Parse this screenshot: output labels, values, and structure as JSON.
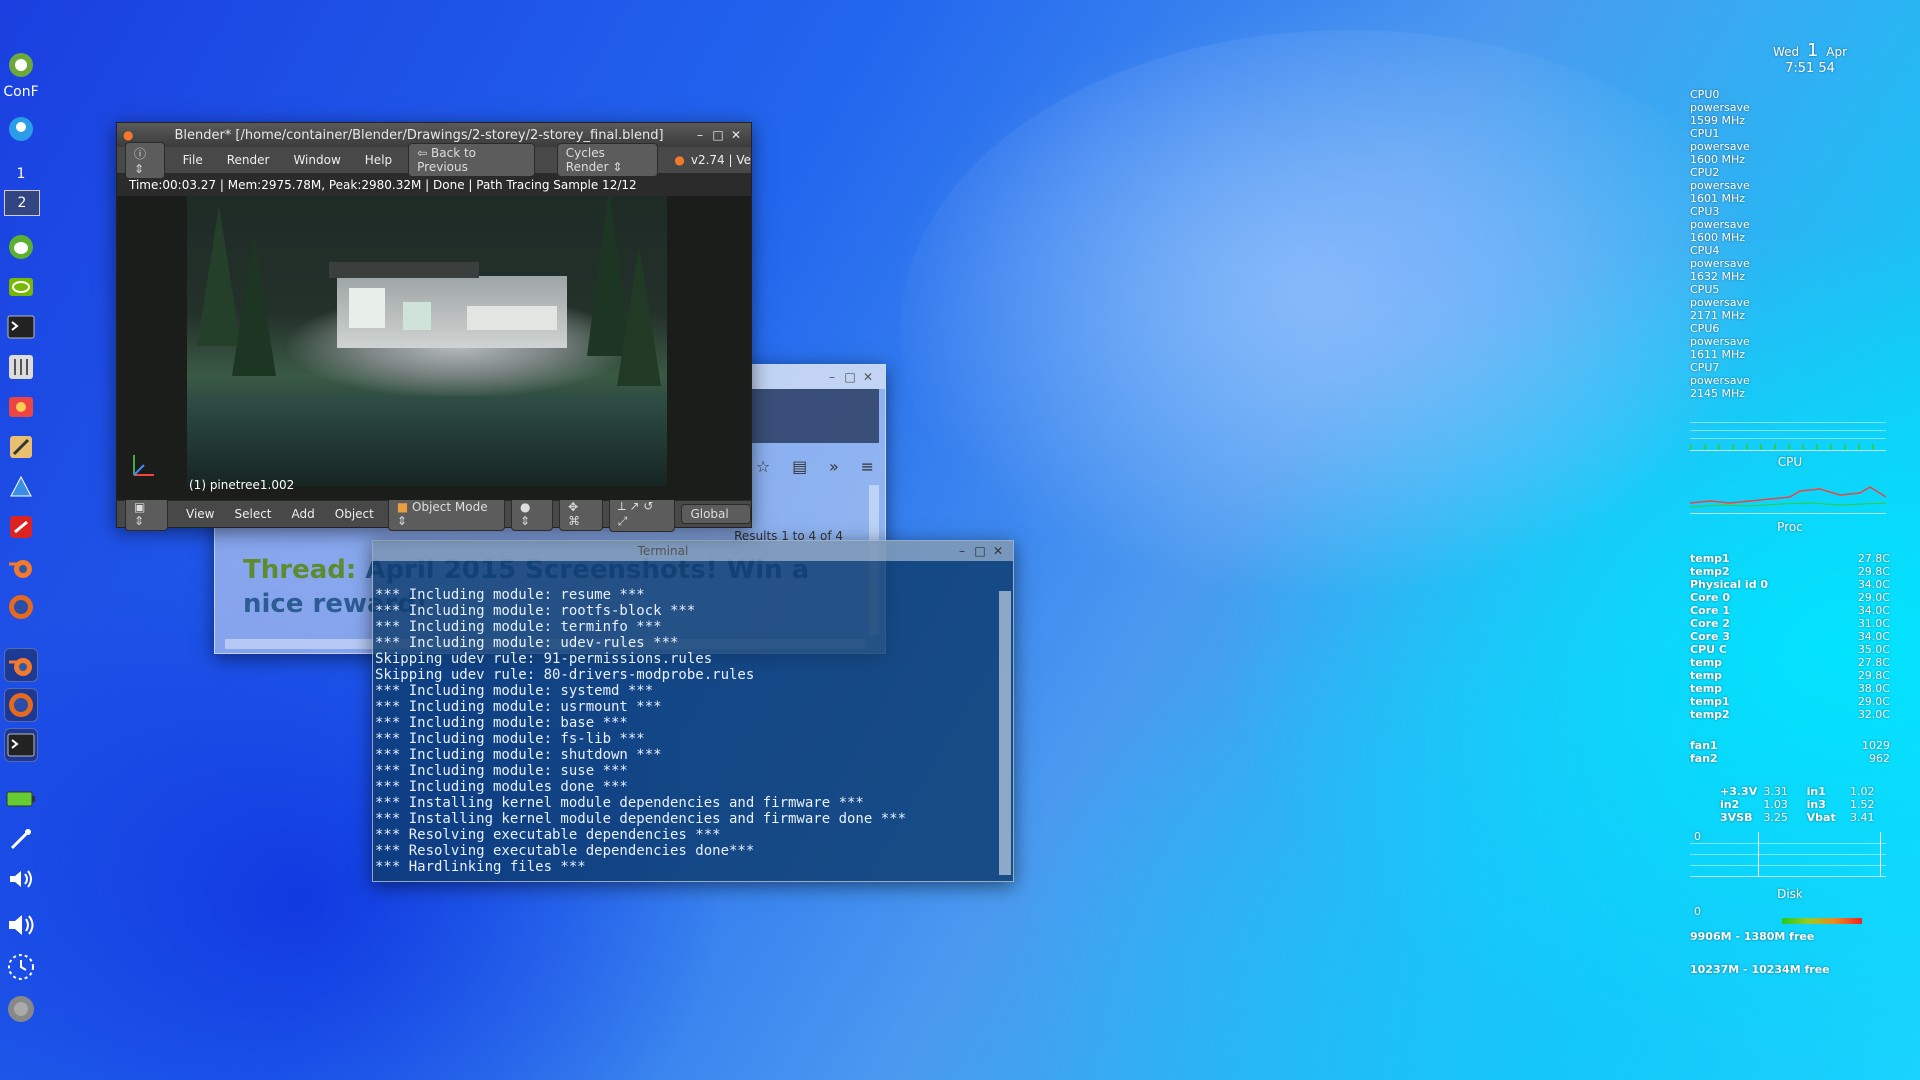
{
  "dock": {
    "conf_label": "ConF",
    "workspace_1": "1",
    "workspace_2": "2"
  },
  "blender": {
    "title": "Blender* [/home/container/Blender/Drawings/2-storey/2-storey_final.blend]",
    "menu": [
      "File",
      "Render",
      "Window",
      "Help"
    ],
    "back_label": "Back to Previous",
    "engine": "Cycles Render",
    "version": "v2.74 | Ve",
    "status": "Time:00:03.27 | Mem:2975.78M, Peak:2980.32M | Done | Path Tracing Sample 12/12",
    "object_name": "(1) pinetree1.002",
    "bottom_menu": [
      "View",
      "Select",
      "Add",
      "Object"
    ],
    "mode": "Object Mode",
    "orientation": "Global"
  },
  "browser": {
    "results": "Results 1 to 4 of 4",
    "thread_label": "Thread:",
    "thread_title": "April 2015 Screenshots! Win a nice reward!"
  },
  "terminal": {
    "title": "Terminal",
    "lines": [
      "*** Including module: resume ***",
      "*** Including module: rootfs-block ***",
      "*** Including module: terminfo ***",
      "*** Including module: udev-rules ***",
      "Skipping udev rule: 91-permissions.rules",
      "Skipping udev rule: 80-drivers-modprobe.rules",
      "*** Including module: systemd ***",
      "*** Including module: usrmount ***",
      "*** Including module: base ***",
      "*** Including module: fs-lib ***",
      "*** Including module: shutdown ***",
      "*** Including module: suse ***",
      "*** Including modules done ***",
      "*** Installing kernel module dependencies and firmware ***",
      "*** Installing kernel module dependencies and firmware done ***",
      "*** Resolving executable dependencies ***",
      "*** Resolving executable dependencies done***",
      "*** Hardlinking files ***"
    ]
  },
  "conky": {
    "day": "Wed",
    "date": "1",
    "month": "Apr",
    "time": "7:51 54",
    "cpus": [
      {
        "name": "CPU0",
        "gov": "powersave",
        "freq": "1599 MHz"
      },
      {
        "name": "CPU1",
        "gov": "powersave",
        "freq": "1600 MHz"
      },
      {
        "name": "CPU2",
        "gov": "powersave",
        "freq": "1601 MHz"
      },
      {
        "name": "CPU3",
        "gov": "powersave",
        "freq": "1600 MHz"
      },
      {
        "name": "CPU4",
        "gov": "powersave",
        "freq": "1632 MHz"
      },
      {
        "name": "CPU5",
        "gov": "powersave",
        "freq": "2171 MHz"
      },
      {
        "name": "CPU6",
        "gov": "powersave",
        "freq": "1611 MHz"
      },
      {
        "name": "CPU7",
        "gov": "powersave",
        "freq": "2145 MHz"
      }
    ],
    "cpu_label": "CPU",
    "proc_label": "Proc",
    "temps": [
      {
        "name": "temp1",
        "value": "27.8C"
      },
      {
        "name": "temp2",
        "value": "29.8C"
      },
      {
        "name": "Physical id 0",
        "value": "34.0C"
      },
      {
        "name": "Core 0",
        "value": "29.0C"
      },
      {
        "name": "Core 1",
        "value": "34.0C"
      },
      {
        "name": "Core 2",
        "value": "31.0C"
      },
      {
        "name": "Core 3",
        "value": "34.0C"
      },
      {
        "name": "CPU C",
        "value": "35.0C"
      },
      {
        "name": "temp",
        "value": "27.8C"
      },
      {
        "name": "temp",
        "value": "29.8C"
      },
      {
        "name": "temp",
        "value": "38.0C"
      },
      {
        "name": "temp1",
        "value": "29.0C"
      },
      {
        "name": "temp2",
        "value": "32.0C"
      }
    ],
    "fans": [
      {
        "name": "fan1",
        "value": "1029"
      },
      {
        "name": "fan2",
        "value": "962"
      }
    ],
    "volts": [
      {
        "a": "+3.3V",
        "av": "3.31",
        "b": "in1",
        "bv": "1.02"
      },
      {
        "a": "in2",
        "av": "1.03",
        "b": "in3",
        "bv": "1.52"
      },
      {
        "a": "3VSB",
        "av": "3.25",
        "b": "Vbat",
        "bv": "3.41"
      }
    ],
    "graph_zero_1": "0",
    "disk_label": "Disk",
    "graph_zero_2": "0",
    "disk1": "9906M - 1380M free",
    "disk2": "10237M - 10234M free"
  },
  "colors": {
    "blender_bg": "#3d3d3d",
    "terminal_bg": "#0e3c6e",
    "thread_blue": "#2b5d94",
    "thread_green": "#5d8c2e"
  }
}
